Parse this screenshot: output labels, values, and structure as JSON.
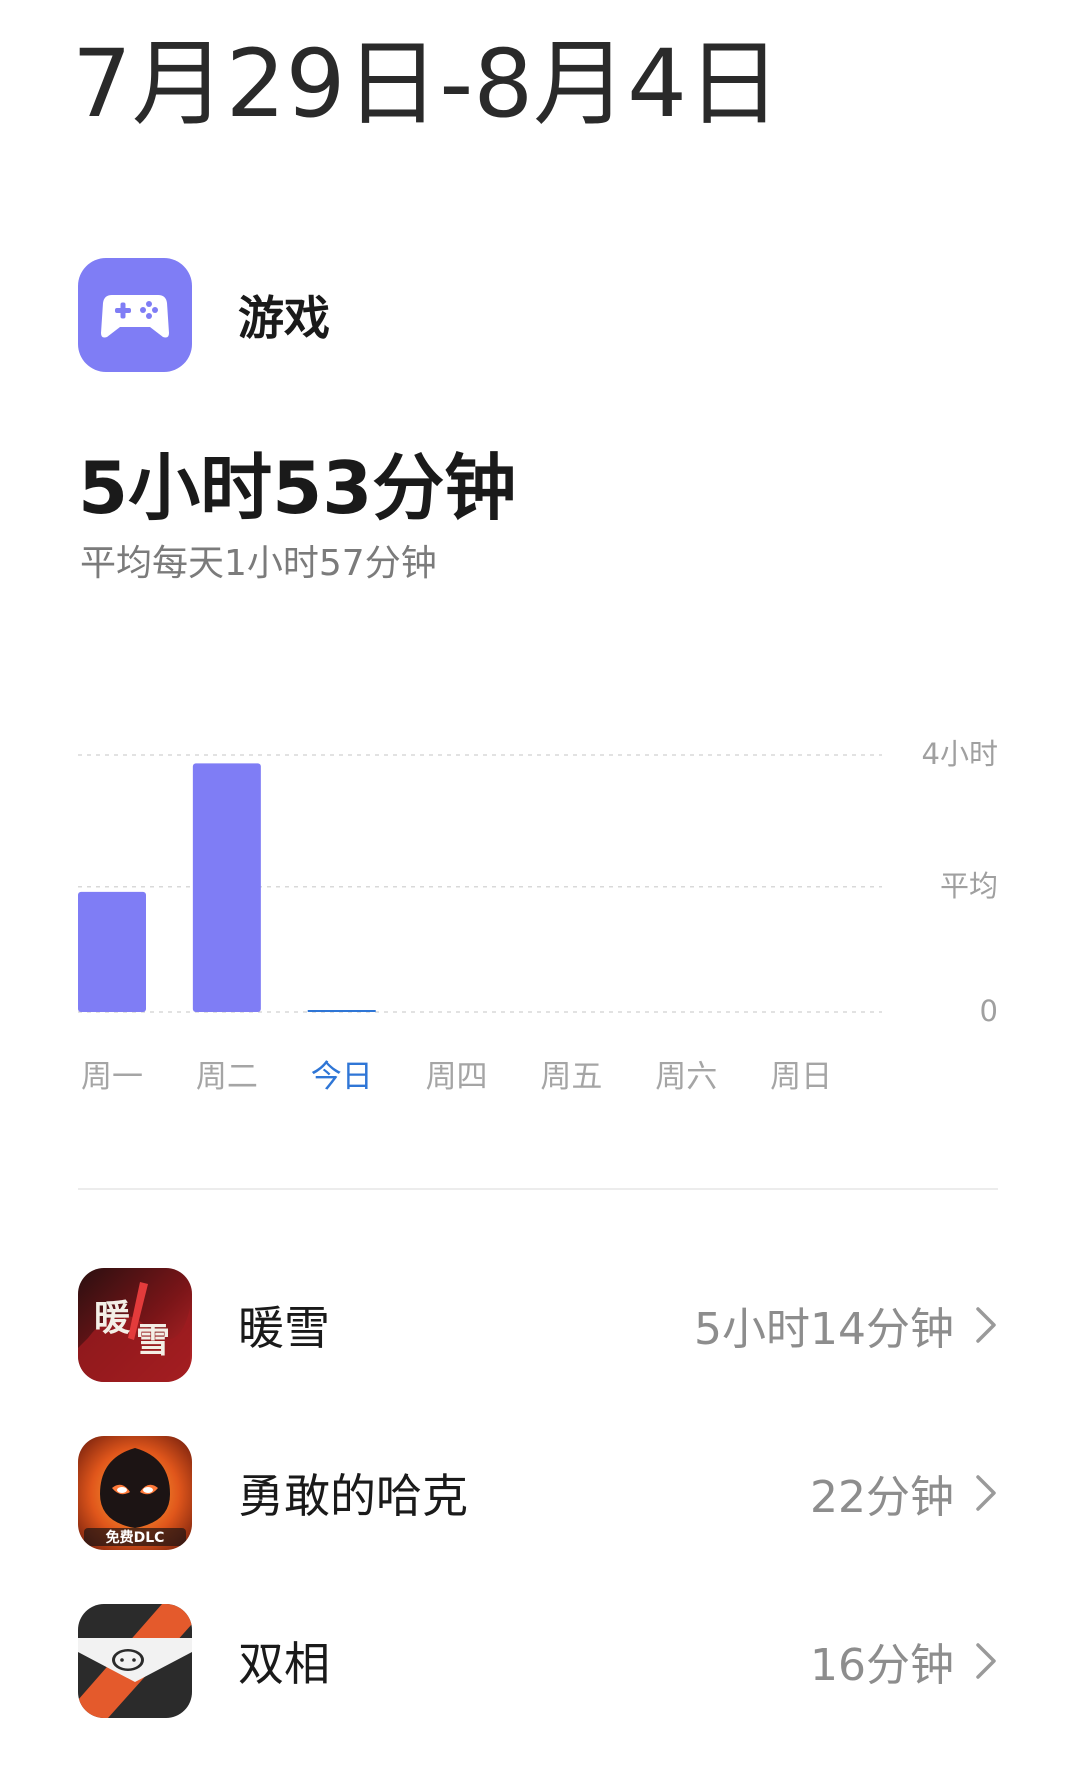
{
  "header": {
    "date_range": "7月29日-8月4日"
  },
  "category": {
    "icon": "gamepad-icon",
    "label": "游戏",
    "icon_color": "#7f7df5"
  },
  "summary": {
    "total": "5小时53分钟",
    "daily_average": "平均每天1小时57分钟"
  },
  "chart_data": {
    "type": "bar",
    "categories": [
      "周一",
      "周二",
      "今日",
      "周四",
      "周五",
      "周六",
      "周日"
    ],
    "values_hours": [
      1.87,
      3.87,
      0.02,
      0,
      0,
      0,
      0
    ],
    "y_tick_labels": [
      "4小时",
      "平均",
      "0"
    ],
    "ylim_hours": [
      0,
      4
    ],
    "reference_line": {
      "label": "平均",
      "value_hours": 1.95
    },
    "highlighted_category": "今日",
    "bar_color": "#7f7df5",
    "highlight_color": "#2f76d6",
    "grid": true
  },
  "apps": [
    {
      "name": "暖雪",
      "time": "5小时14分钟",
      "icon": "nuanxue-app-icon"
    },
    {
      "name": "勇敢的哈克",
      "time": "22分钟",
      "icon": "brave-hark-app-icon",
      "icon_text": "免费DLC"
    },
    {
      "name": "双相",
      "time": "16分钟",
      "icon": "shuangxiang-app-icon"
    }
  ]
}
